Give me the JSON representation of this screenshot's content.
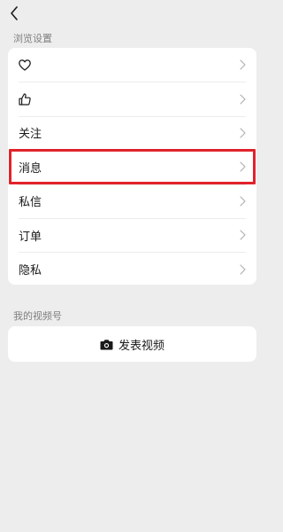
{
  "header": {
    "back_icon": "chevron-left-icon"
  },
  "sections": {
    "browse_label": "浏览设置",
    "channel_label": "我的视频号"
  },
  "settings_rows": [
    {
      "label": "",
      "icon": "heart-outline-icon"
    },
    {
      "label": "",
      "icon": "thumbs-up-icon"
    },
    {
      "label": "关注",
      "icon": ""
    },
    {
      "label": "消息",
      "icon": "",
      "highlighted": true
    },
    {
      "label": "私信",
      "icon": ""
    },
    {
      "label": "订单",
      "icon": ""
    },
    {
      "label": "隐私",
      "icon": ""
    }
  ],
  "publish": {
    "label": "发表视频",
    "icon": "camera-icon"
  },
  "colors": {
    "highlight": "#e0232b",
    "background": "#ededed",
    "card": "#ffffff"
  }
}
